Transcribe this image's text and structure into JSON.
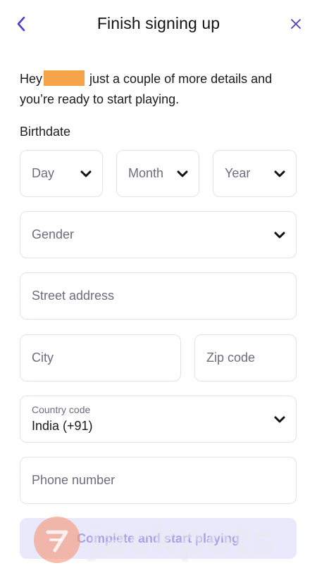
{
  "header": {
    "title": "Finish signing up",
    "back_icon": "chevron-left-icon",
    "close_icon": "close-icon",
    "accent_color": "#4a3fc7"
  },
  "greeting": {
    "prefix": "Hey",
    "suffix": " just a couple of more details and you’re ready to start playing."
  },
  "birthdate": {
    "label": "Birthdate",
    "day_placeholder": "Day",
    "month_placeholder": "Month",
    "year_placeholder": "Year"
  },
  "fields": {
    "gender_placeholder": "Gender",
    "street_placeholder": "Street address",
    "city_placeholder": "City",
    "zip_placeholder": "Zip code",
    "country_code_label": "Country code",
    "country_code_value": "India (+91)",
    "phone_placeholder": "Phone number"
  },
  "submit": {
    "label": "Complete and start playing",
    "background": "#eae9fb",
    "text_color": "#a9a3e6"
  },
  "watermark": {
    "text": "jackpots"
  }
}
